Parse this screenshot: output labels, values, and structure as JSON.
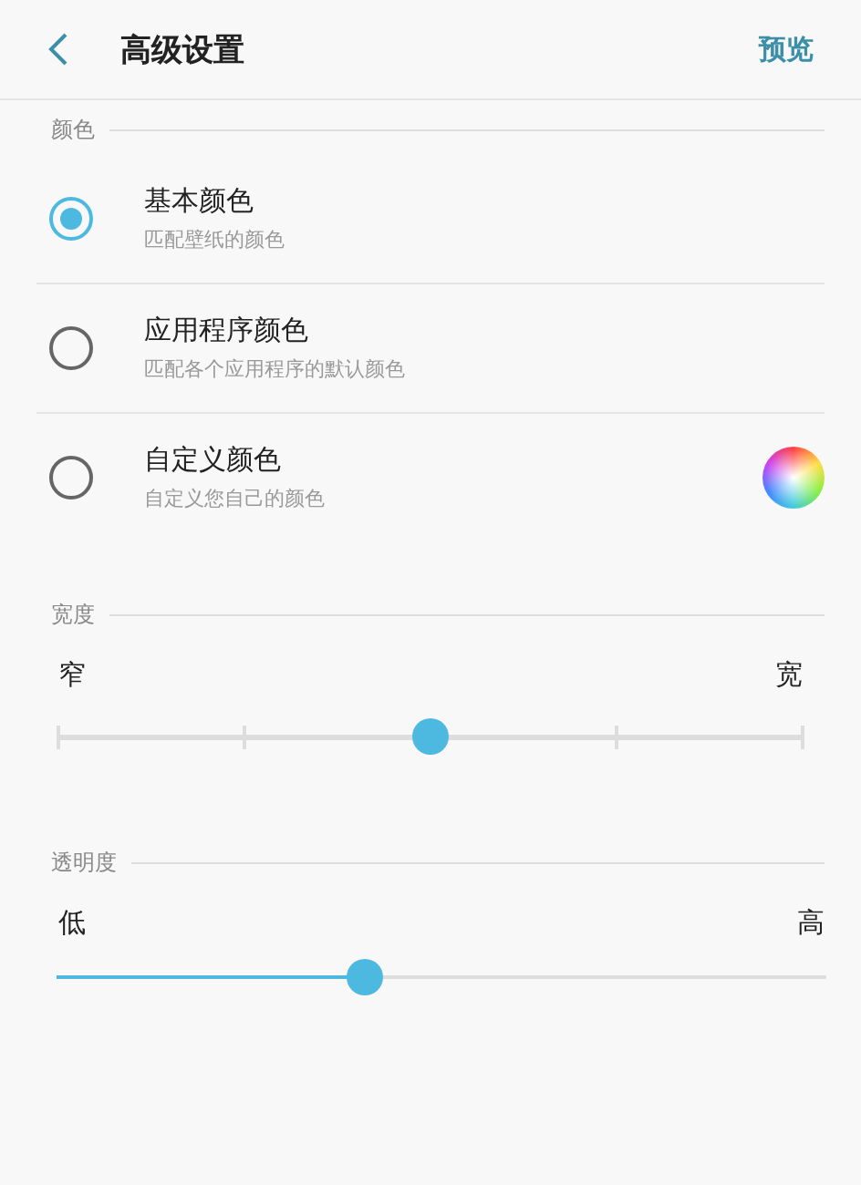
{
  "header": {
    "title": "高级设置",
    "action": "预览"
  },
  "color_section": {
    "heading": "颜色",
    "options": [
      {
        "title": "基本颜色",
        "subtitle": "匹配壁纸的颜色",
        "selected": true,
        "kind": "plain"
      },
      {
        "title": "应用程序颜色",
        "subtitle": "匹配各个应用程序的默认颜色",
        "selected": false,
        "kind": "plain"
      },
      {
        "title": "自定义颜色",
        "subtitle": "自定义您自己的颜色",
        "selected": false,
        "kind": "picker"
      }
    ]
  },
  "sliders": [
    {
      "heading": "宽度",
      "min_label": "窄",
      "max_label": "宽",
      "kind": "stepped",
      "level": 0.5
    },
    {
      "heading": "透明度",
      "min_label": "低",
      "max_label": "高",
      "kind": "continuous",
      "level": 0.4
    }
  ]
}
